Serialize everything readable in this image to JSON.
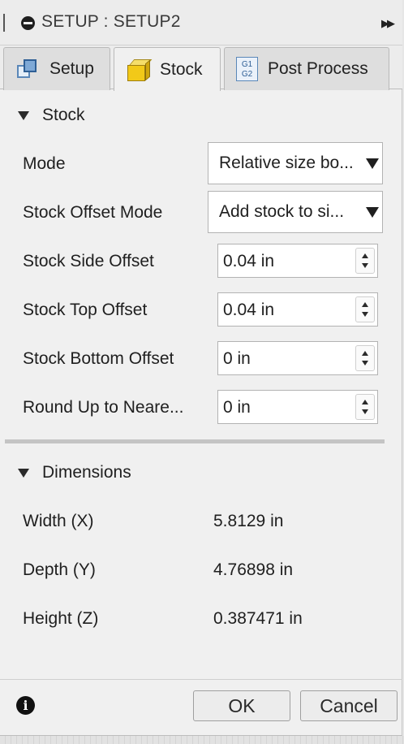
{
  "title_bar": {
    "title": "SETUP : SETUP2",
    "expand_glyph": "▶▶"
  },
  "tabs": [
    {
      "label": "Setup",
      "icon": "setup-cube-icon",
      "active": false
    },
    {
      "label": "Stock",
      "icon": "stock-cube-icon",
      "active": true
    },
    {
      "label": "Post Process",
      "icon": "g1g2-icon",
      "icon_text": [
        "G1",
        "G2"
      ],
      "active": false
    }
  ],
  "stock_section": {
    "header": "Stock",
    "fields": [
      {
        "label": "Mode",
        "type": "dropdown",
        "value": "Relative size bo..."
      },
      {
        "label": "Stock Offset Mode",
        "type": "dropdown",
        "value": "Add stock to si..."
      },
      {
        "label": "Stock Side Offset",
        "type": "spinner",
        "value": "0.04 in"
      },
      {
        "label": "Stock Top Offset",
        "type": "spinner",
        "value": "0.04 in"
      },
      {
        "label": "Stock Bottom Offset",
        "type": "spinner",
        "value": "0 in"
      },
      {
        "label": "Round Up to Neare...",
        "type": "spinner",
        "value": "0 in"
      }
    ]
  },
  "dimensions_section": {
    "header": "Dimensions",
    "rows": [
      {
        "label": "Width (X)",
        "value": "5.8129 in"
      },
      {
        "label": "Depth (Y)",
        "value": "4.76898 in"
      },
      {
        "label": "Height (Z)",
        "value": "0.387471 in"
      }
    ]
  },
  "footer": {
    "info_glyph": "i",
    "ok_label": "OK",
    "cancel_label": "Cancel"
  },
  "colors": {
    "panel_bg": "#f0f0f0",
    "stock_icon": "#f2c918",
    "setup_icon": "#2f5f95"
  }
}
